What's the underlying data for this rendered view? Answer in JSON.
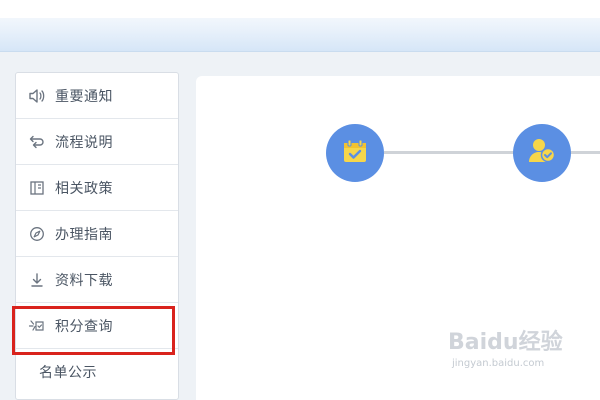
{
  "sidebar": {
    "items": [
      {
        "label": "重要通知",
        "icon": "speaker-icon"
      },
      {
        "label": "流程说明",
        "icon": "flow-icon"
      },
      {
        "label": "相关政策",
        "icon": "book-icon"
      },
      {
        "label": "办理指南",
        "icon": "compass-icon"
      },
      {
        "label": "资料下载",
        "icon": "download-icon"
      },
      {
        "label": "积分查询",
        "icon": "star-check-icon",
        "highlighted": true
      },
      {
        "label": "名单公示",
        "icon": ""
      }
    ]
  },
  "main": {
    "steps": [
      {
        "icon": "calendar-check-icon"
      },
      {
        "icon": "user-check-icon"
      }
    ]
  },
  "watermark": {
    "text": "Baidu经验",
    "url": "jingyan.baidu.com"
  },
  "colors": {
    "step_circle": "#5b8fe3",
    "step_icon": "#f6d64a",
    "highlight": "#d9231d",
    "sidebar_text": "#4a5563"
  }
}
